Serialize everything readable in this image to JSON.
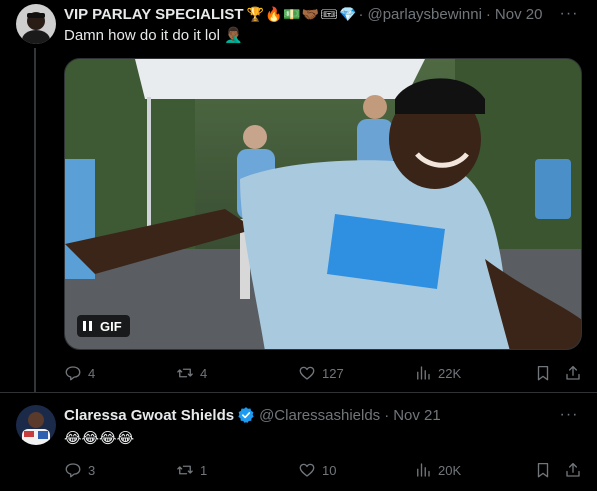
{
  "tweets": [
    {
      "name": "VIP PARLAY SPECIALIST",
      "emojis": [
        "trophy",
        "fire",
        "money",
        "handshake",
        "ticket",
        "gem"
      ],
      "handle": "@parlaysbewinni",
      "separator": "·",
      "date": "Nov 20",
      "more": "···",
      "text": "Damn how do it do it lol 🤦🏾‍♂️",
      "media": {
        "badge": "GIF"
      },
      "replies": "4",
      "reposts": "4",
      "likes": "127",
      "views": "22K"
    },
    {
      "name": "Claressa Gwoat Shields",
      "verified": true,
      "handle": "@Claressashields",
      "separator": "·",
      "date": "Nov 21",
      "more": "···",
      "text": "😂😂😂😂",
      "replies": "3",
      "reposts": "1",
      "likes": "10",
      "views": "20K"
    }
  ],
  "colors": {
    "background": "#000000",
    "primary_text": "#e7e9ea",
    "secondary_text": "#71767b",
    "divider": "#2f3336",
    "verified_blue": "#1d9bf0"
  },
  "icons": [
    "reply-icon",
    "repost-icon",
    "like-icon",
    "views-icon",
    "bookmark-icon",
    "share-icon",
    "more-icon",
    "pause-icon",
    "verified-icon"
  ]
}
